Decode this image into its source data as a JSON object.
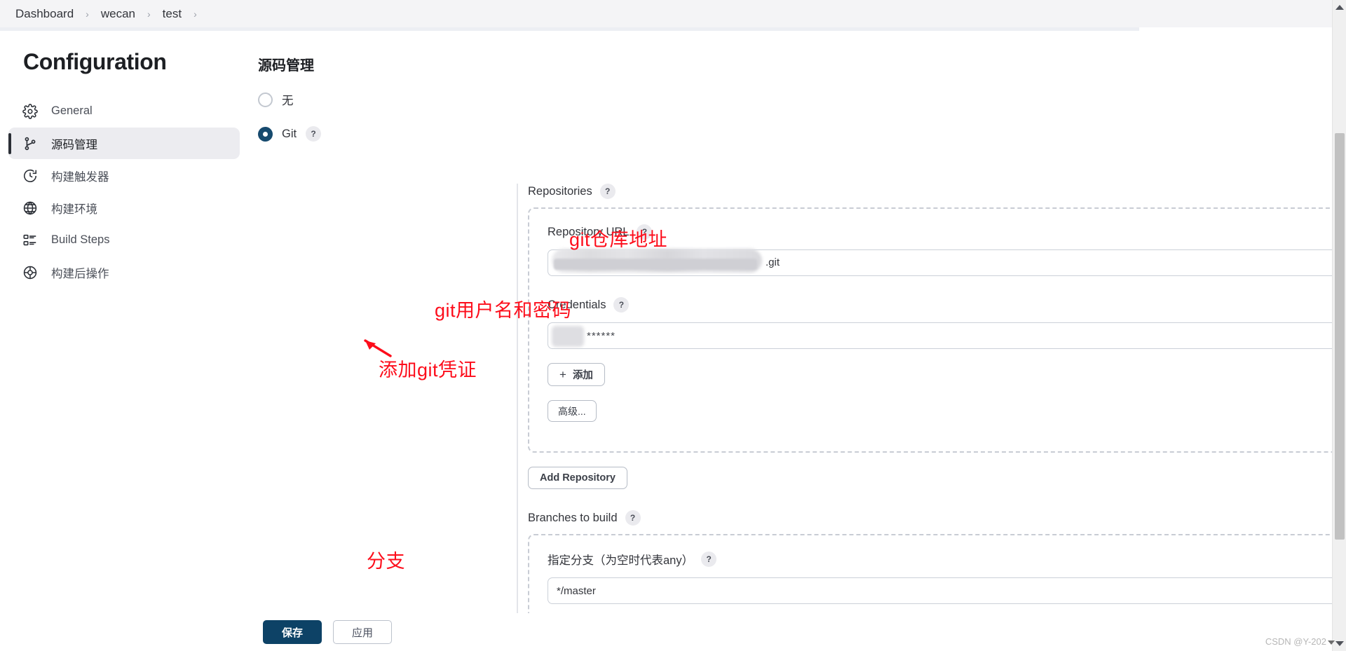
{
  "breadcrumb": {
    "items": [
      "Dashboard",
      "wecan",
      "test"
    ],
    "separator": "›"
  },
  "sidebar": {
    "title": "Configuration",
    "items": [
      {
        "label": "General",
        "icon": "gear-icon",
        "active": false
      },
      {
        "label": "源码管理",
        "icon": "source-branch-icon",
        "active": true
      },
      {
        "label": "构建触发器",
        "icon": "clock-icon",
        "active": false
      },
      {
        "label": "构建环境",
        "icon": "globe-icon",
        "active": false
      },
      {
        "label": "Build Steps",
        "icon": "list-icon",
        "active": false
      },
      {
        "label": "构建后操作",
        "icon": "package-icon",
        "active": false
      }
    ]
  },
  "main": {
    "section_title": "源码管理",
    "scm_options": [
      {
        "label": "无",
        "checked": false,
        "help": false
      },
      {
        "label": "Git",
        "checked": true,
        "help": true
      }
    ],
    "repositories": {
      "label": "Repositories",
      "help": "?",
      "repository_url": {
        "label": "Repository URL",
        "help": "?",
        "value_redacted": true,
        "value_suffix": ".git",
        "placeholder": ""
      },
      "credentials": {
        "label": "Credentials",
        "help": "?",
        "value_redacted": true,
        "value_masked": "******",
        "add_button": "添加",
        "add_button_icon": "plus-icon",
        "advanced_button": "高级..."
      },
      "delete_icon": "close-icon",
      "add_repository_button": "Add Repository"
    },
    "branches": {
      "label": "Branches to build",
      "help": "?",
      "specifier": {
        "label": "指定分支（为空时代表any）",
        "help": "?",
        "value": "*/master",
        "placeholder": ""
      },
      "delete_icon": "close-icon"
    }
  },
  "annotations": [
    {
      "text": "git仓库地址",
      "name": "annotation-repo-url"
    },
    {
      "text": "git用户名和密码",
      "name": "annotation-credentials"
    },
    {
      "text": "添加git凭证",
      "name": "annotation-add-credential"
    },
    {
      "text": "分支",
      "name": "annotation-branch"
    }
  ],
  "footer": {
    "save_label": "保存",
    "apply_label": "应用"
  },
  "watermark": {
    "text": "CSDN @Y-202"
  },
  "colors": {
    "accent": "#0d4266",
    "annotation_red": "#fd0d1b",
    "sidebar_active_bg": "#ececf0",
    "breadcrumb_bg": "#f4f4f6",
    "dashed_border": "#c8ccd4"
  }
}
